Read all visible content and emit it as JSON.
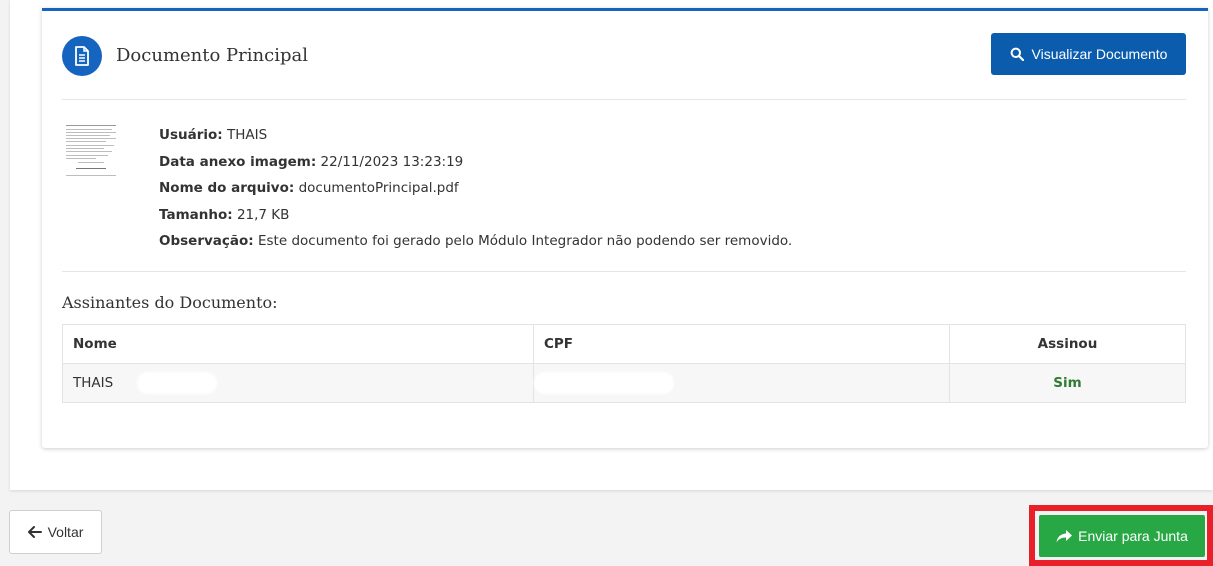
{
  "document": {
    "title": "Documento Principal",
    "view_button_label": "Visualizar Documento",
    "meta": {
      "usuario_label": "Usuário:",
      "usuario_value": "THAIS",
      "data_label": "Data anexo imagem:",
      "data_value": "22/11/2023 13:23:19",
      "arquivo_label": "Nome do arquivo:",
      "arquivo_value": "documentoPrincipal.pdf",
      "tamanho_label": "Tamanho:",
      "tamanho_value": "21,7 KB",
      "obs_label": "Observação:",
      "obs_value": "Este documento foi gerado pelo Módulo Integrador não podendo ser removido."
    }
  },
  "signers": {
    "title": "Assinantes do Documento:",
    "columns": [
      "Nome",
      "CPF",
      "Assinou"
    ],
    "rows": [
      {
        "nome": "THAIS",
        "cpf": "",
        "assinou": "Sim"
      }
    ]
  },
  "footer": {
    "back_label": "Voltar",
    "send_label": "Enviar para Junta"
  },
  "icons": {
    "document": "document-icon",
    "search": "search-icon",
    "arrow_left": "arrow-left-icon",
    "share": "share-arrow-icon"
  },
  "colors": {
    "primary": "#1565c0",
    "button_primary": "#0b5cad",
    "success": "#28a745",
    "sim_text": "#2e7d32",
    "highlight": "#e8202a"
  }
}
